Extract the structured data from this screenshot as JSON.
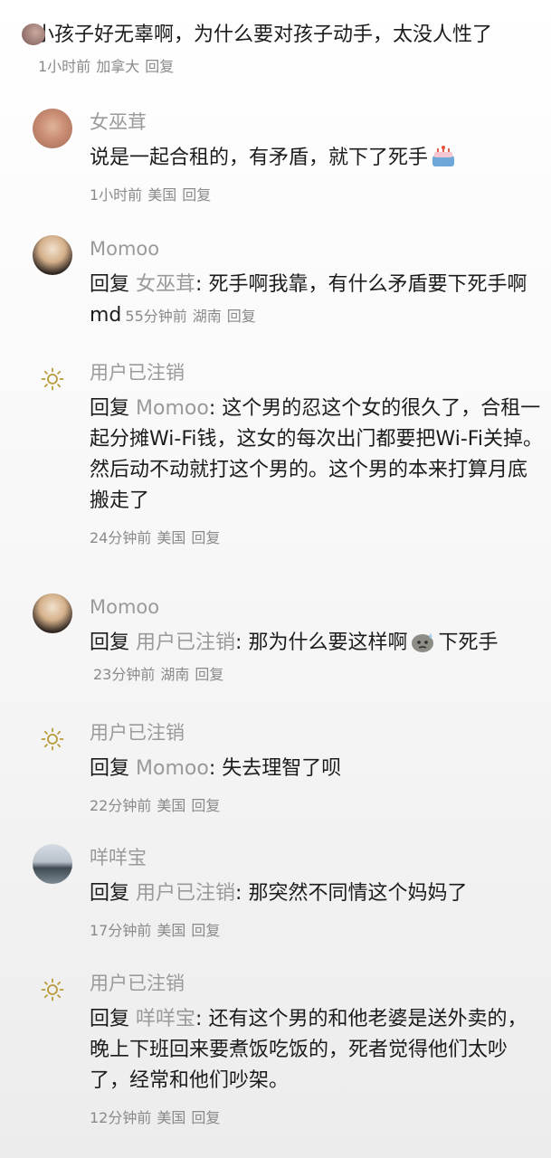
{
  "top_comment": {
    "text": "小孩子好无辜啊，为什么要对孩子动手，太没人性了",
    "time": "1小时前",
    "location": "加拿大",
    "reply": "回复"
  },
  "replies": [
    {
      "name": "女巫茸",
      "avatar": "hand-avatar",
      "text": "说是一起合租的，有矛盾，就下了死手",
      "emoji": "cake-emoji",
      "time": "1小时前",
      "location": "美国",
      "reply": "回复"
    },
    {
      "name": "Momoo",
      "avatar": "face-avatar",
      "prefix": "回复",
      "target": "女巫茸",
      "text": "死手啊我靠，有什么矛盾要下死手啊md",
      "time": "55分钟前",
      "location": "湖南",
      "reply": "回复"
    },
    {
      "name": "用户已注销",
      "avatar": "sun-icon",
      "prefix": "回复",
      "target": "Momoo",
      "text": "这个男的忍这个女的很久了，合租一起分摊Wi-Fi钱，这女的每次出门都要把Wi-Fi关掉。然后动不动就打这个男的。这个男的本来打算月底搬走了",
      "time": "24分钟前",
      "location": "美国",
      "reply": "回复"
    },
    {
      "name": "Momoo",
      "avatar": "face-avatar",
      "prefix": "回复",
      "target": "用户已注销",
      "text": "那为什么要这样啊",
      "emoji": "sweat-emoji",
      "text_after": "下死手",
      "time": "23分钟前",
      "location": "湖南",
      "reply": "回复"
    },
    {
      "name": "用户已注销",
      "avatar": "sun-icon",
      "prefix": "回复",
      "target": "Momoo",
      "text": "失去理智了呗",
      "time": "22分钟前",
      "location": "美国",
      "reply": "回复"
    },
    {
      "name": "咩咩宝",
      "avatar": "sea-avatar",
      "prefix": "回复",
      "target": "用户已注销",
      "text": "那突然不同情这个妈妈了",
      "time": "17分钟前",
      "location": "美国",
      "reply": "回复"
    },
    {
      "name": "用户已注销",
      "avatar": "sun-icon",
      "prefix": "回复",
      "target": "咩咩宝",
      "text": "还有这个男的和他老婆是送外卖的，晚上下班回来要煮饭吃饭的，死者觉得他们太吵了，经常和他们吵架。",
      "time": "12分钟前",
      "location": "美国",
      "reply": "回复"
    }
  ],
  "colors": {
    "meta": "#8a8a8a",
    "name": "#9a9a9a",
    "text": "#1c1c1c"
  }
}
